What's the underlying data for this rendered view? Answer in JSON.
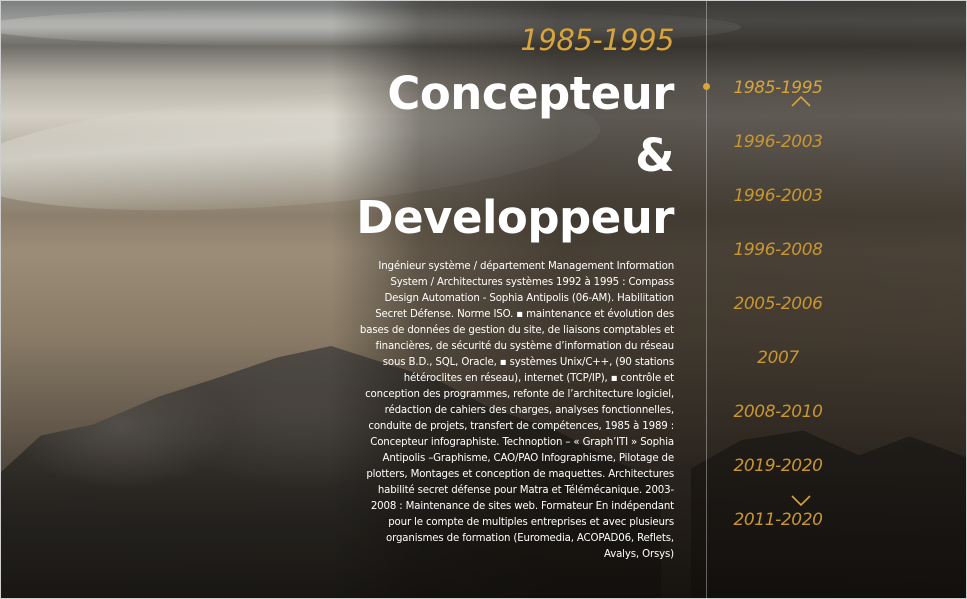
{
  "header": {
    "period": "1985-1995",
    "title_lines": [
      "Concepteur",
      "&",
      "Developpeur"
    ]
  },
  "description": "Ingénieur système / département Management Information System / Architectures systèmes 1992 à 1995 : Compass Design Automation - Sophia Antipolis (06-AM). Habilitation Secret Défense. Norme ISO. ▪ maintenance et évolution des bases de données de gestion du site, de liaisons comptables et financières, de sécurité du système d’information du réseau sous B.D., SQL, Oracle, ▪ systèmes Unix/C++, (90 stations hétéroclites en réseau), internet (TCP/IP), ▪ contrôle et conception des programmes, refonte de l’architecture logiciel, rédaction de cahiers des charges, analyses fonctionnelles, conduite de projets, transfert de compétences, 1985 à 1989 : Concepteur infographiste. Technoption – « Graph’ITI » Sophia Antipolis –Graphisme, CAO/PAO Infographisme, Pilotage de plotters, Montages et conception de maquettes. Architectures habilité secret défense pour Matra et Télémécanique. 2003-2008 : Maintenance de sites web. Formateur En indépendant pour le compte de multiples entreprises et avec plusieurs organismes de formation (Euromedia, ACOPAD06, Reflets, Avalys, Orsys)",
  "timeline": {
    "items": [
      "1985-1995",
      "1996-2003",
      "1996-2003",
      "1996-2008",
      "2005-2006",
      "2007",
      "2008-2010",
      "2019-2020",
      "2011-2020"
    ],
    "active_index": 0,
    "prev_icon": "chevron-up-icon",
    "next_icon": "chevron-down-icon"
  },
  "colors": {
    "accent": "#d8a43b",
    "text": "#ffffff"
  }
}
